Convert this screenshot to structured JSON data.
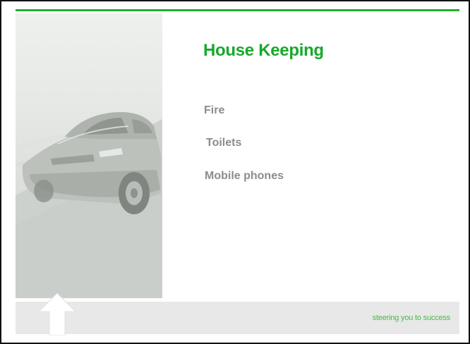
{
  "slide": {
    "title": "House Keeping",
    "bullets": [
      {
        "label": "Fire"
      },
      {
        "label": "Toilets"
      },
      {
        "label": "Mobile phones"
      }
    ],
    "tagline": "steering you to success"
  },
  "images": {
    "photo": "car-photo",
    "logo": "up-arrow-icon"
  },
  "colors": {
    "accent": "#20b030",
    "title": "#18a82a",
    "bullet_text": "#8c8c8c",
    "footer_band": "#e8e8e8",
    "tagline": "#44bb44"
  }
}
